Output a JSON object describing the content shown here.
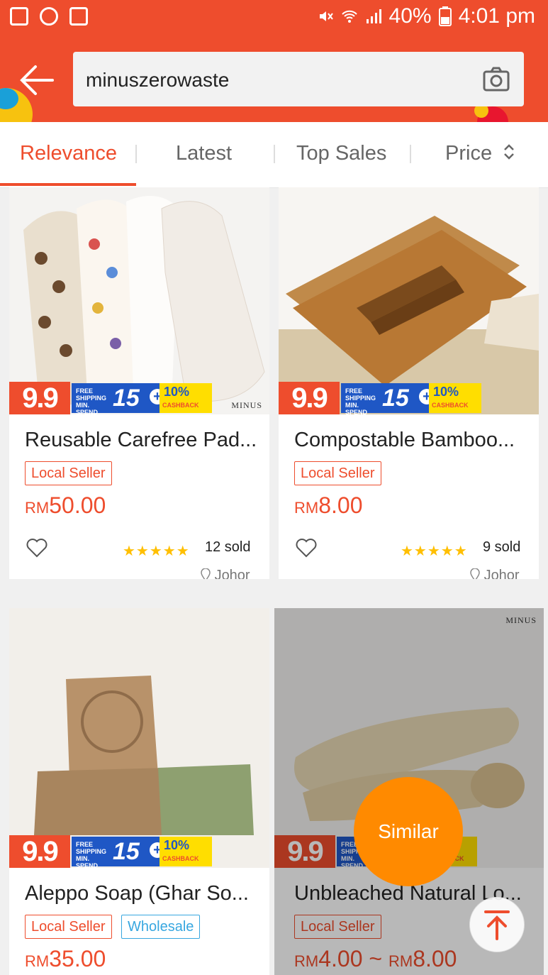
{
  "status_bar": {
    "battery": "40%",
    "time": "4:01 pm"
  },
  "search": {
    "query": "minuszerowaste"
  },
  "tabs": [
    {
      "label": "Relevance"
    },
    {
      "label": "Latest"
    },
    {
      "label": "Top Sales"
    },
    {
      "label": "Price"
    }
  ],
  "products": [
    {
      "title": "Reusable Carefree Pad...",
      "tags": [
        "Local Seller"
      ],
      "currency": "RM",
      "price": "50.00",
      "sold": "12 sold",
      "location": "Johor"
    },
    {
      "title": "Compostable Bamboo...",
      "tags": [
        "Local Seller"
      ],
      "currency": "RM",
      "price": "8.00",
      "sold": "9 sold",
      "location": "Johor"
    },
    {
      "title": "Aleppo Soap (Ghar So...",
      "tags": [
        "Local Seller",
        "Wholesale"
      ],
      "currency": "RM",
      "price": "35.00"
    },
    {
      "title": "Unbleached Natural Lo...",
      "tags": [
        "Local Seller"
      ],
      "currency": "RM",
      "price": "4.00",
      "currency2": "RM",
      "price2": "8.00",
      "price_sep": "~"
    }
  ],
  "banner": {
    "sale": "9.9",
    "free_shipping": "FREE SHIPPING MIN. SPEND",
    "amount": "15",
    "plus": "+",
    "cashback_pct": "10%",
    "cashback": "CASHBACK"
  },
  "brand_mark": "MINUS",
  "similar_label": "Similar",
  "colors": {
    "accent": "#ee4d2d",
    "similar": "#ff8a00",
    "star": "#ffbf00"
  }
}
